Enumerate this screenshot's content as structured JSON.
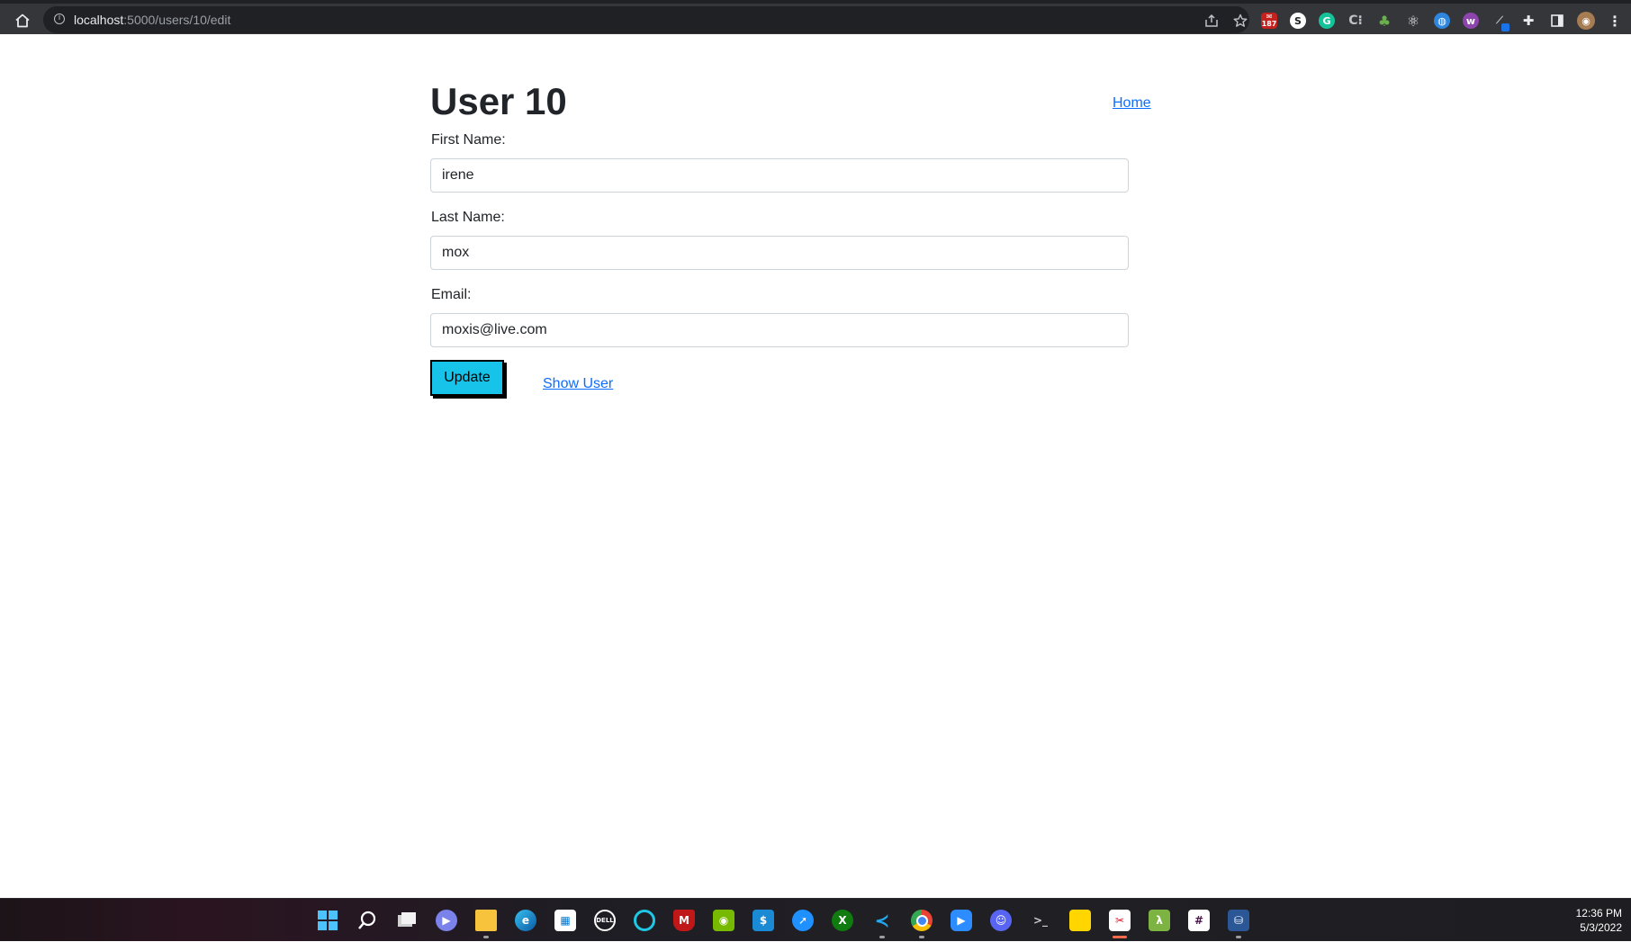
{
  "browser": {
    "url_host": "localhost",
    "url_path": ":5000/users/10/edit",
    "extension_badge": "187",
    "toolbar_icons": [
      "share-icon",
      "star-icon",
      "mail-extension-icon",
      "s-extension-icon",
      "grammarly-icon",
      "c-extension-icon",
      "tree-extension-icon",
      "react-devtools-icon",
      "globe-extension-icon",
      "w-extension-icon",
      "pen-extension-icon",
      "puzzle-icon",
      "side-panel-icon",
      "profile-avatar",
      "menu-kebab-icon"
    ]
  },
  "page": {
    "title": "User 10",
    "home_link": "Home",
    "form": {
      "first_name_label": "First Name:",
      "first_name_value": "irene",
      "last_name_label": "Last Name:",
      "last_name_value": "mox",
      "email_label": "Email:",
      "email_value": "moxis@live.com",
      "update_button": "Update",
      "show_user_link": "Show User"
    },
    "colors": {
      "button_bg": "#17c3e8",
      "link": "#0d6efd"
    }
  },
  "taskbar": {
    "apps": [
      "windows-start-icon",
      "search-icon",
      "task-view-icon",
      "teams-chat-icon",
      "file-explorer-icon",
      "edge-icon",
      "store-icon",
      "dell-icon",
      "alexa-icon",
      "mcafee-icon",
      "nvidia-icon",
      "phone-link-icon",
      "safari-like-icon",
      "xbox-icon",
      "vscode-icon",
      "chrome-icon",
      "zoom-icon",
      "discord-icon",
      "terminal-icon",
      "sticky-notes-icon",
      "snipping-tool-icon",
      "lambda-icon",
      "slack-icon",
      "sql-icon"
    ],
    "time": "12:36 PM",
    "date": "5/3/2022"
  }
}
